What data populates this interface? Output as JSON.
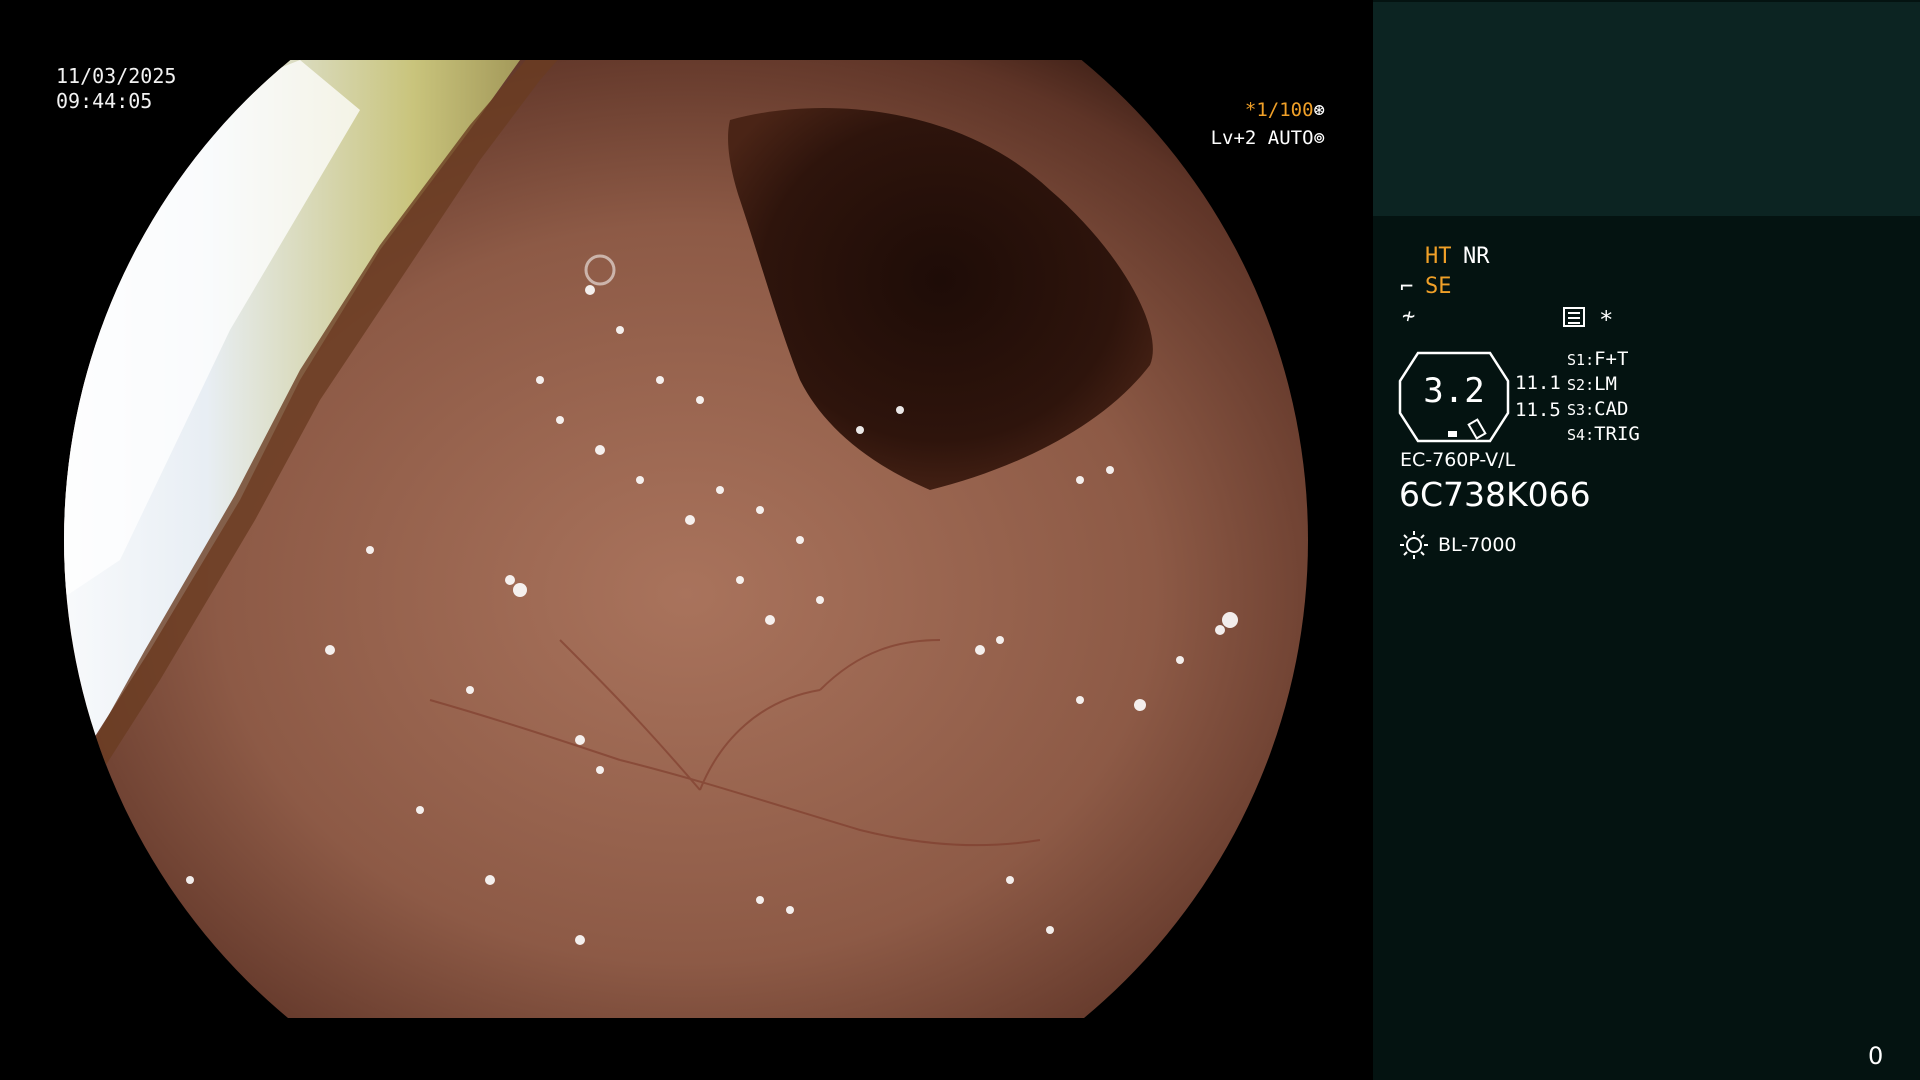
{
  "video": {
    "date": "11/03/2025",
    "time": "09:44:05",
    "shutter_value": "*1/100",
    "shutter_icon": "aperture-icon",
    "level_value": "Lv+2 AUTO",
    "level_icon": "iris-icon"
  },
  "panel": {
    "ht_label": "HT",
    "nr_label": "NR",
    "se_icon": "structure-enhance-icon",
    "se_label": "SE",
    "f_icon": "filter-icon",
    "menu_icon": "menu-icon",
    "star_label": "*",
    "zoom_value": "3.2",
    "value_1": "11.1",
    "value_2": "11.5",
    "switches": [
      {
        "key": "S1",
        "label": "F+T"
      },
      {
        "key": "S2",
        "label": "LM"
      },
      {
        "key": "S3",
        "label": "CAD"
      },
      {
        "key": "S4",
        "label": "TRIG"
      }
    ],
    "scope_model": "EC-760P-V/L",
    "serial": "6C738K066",
    "light_icon": "light-source-icon",
    "light_source": "BL-7000",
    "frame_counter": "0"
  },
  "colors": {
    "accent_orange": "#f0a028",
    "panel_bg": "#041311",
    "panel_top_bg": "#0c2422",
    "mucosa": "#8f5e4a"
  }
}
